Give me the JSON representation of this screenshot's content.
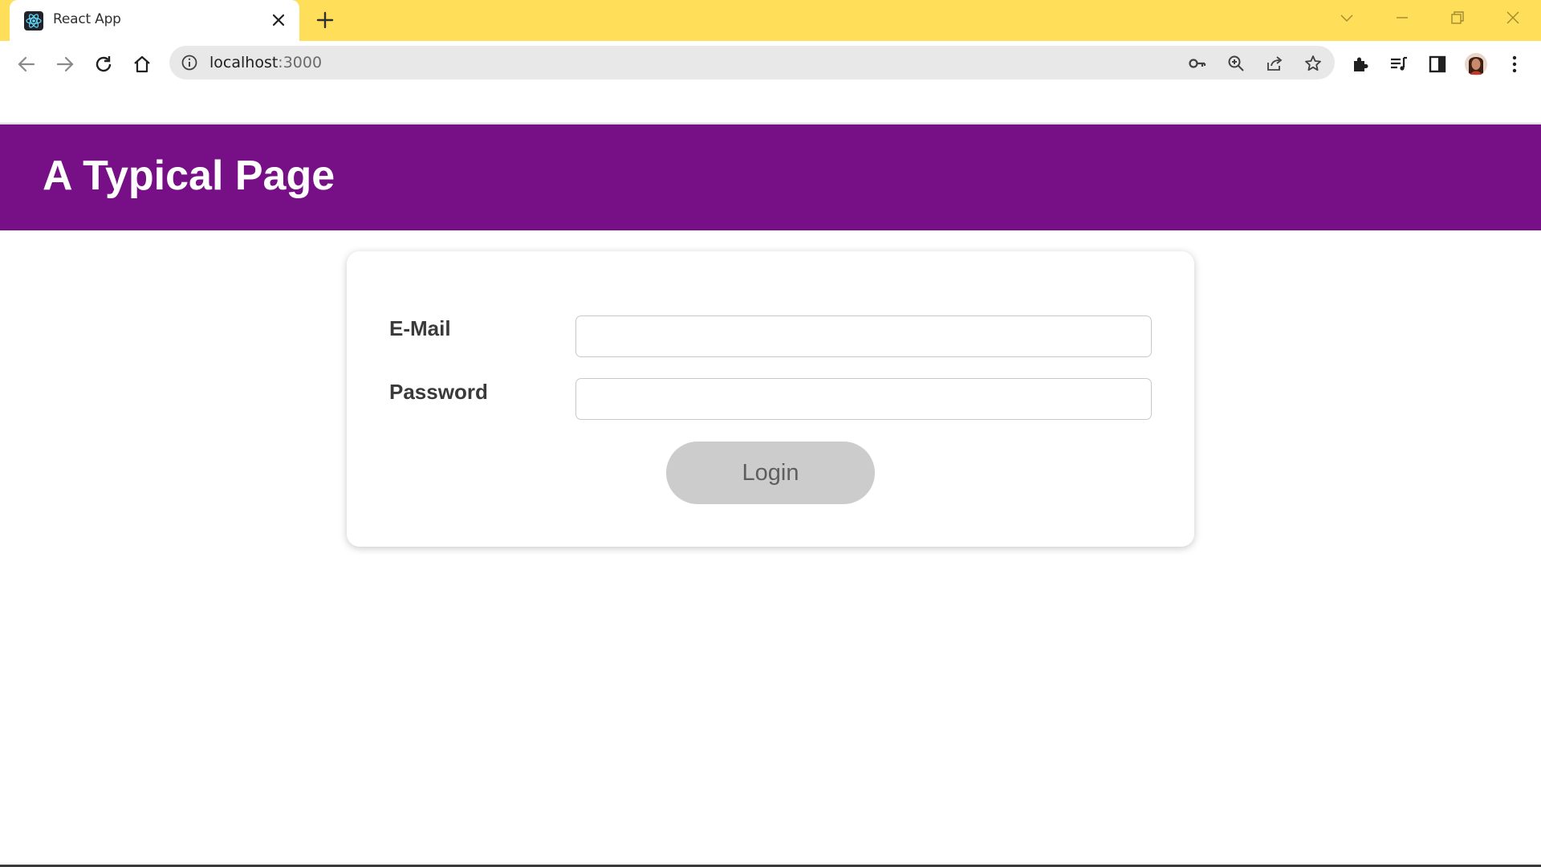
{
  "browser": {
    "tab_title": "React App",
    "url_host": "localhost",
    "url_port": ":3000",
    "icons": {
      "favicon": "react-logo-icon",
      "tab_close": "close-icon",
      "new_tab": "plus-icon",
      "tab_search": "chevron-down-icon",
      "minimize": "minimize-icon",
      "restore": "restore-icon",
      "close_window": "close-icon",
      "back": "arrow-left-icon",
      "forward": "arrow-right-icon",
      "reload": "reload-icon",
      "home": "home-icon",
      "site_info": "info-icon",
      "password": "key-icon",
      "zoom": "zoom-in-icon",
      "share": "share-icon",
      "bookmark": "star-icon",
      "extensions": "puzzle-icon",
      "media": "media-queue-icon",
      "side_panel": "side-panel-icon",
      "profile": "avatar",
      "menu": "kebab-menu-icon"
    },
    "colors": {
      "tabbar": "#ffde5a"
    }
  },
  "page": {
    "title": "A Typical Page",
    "header_color": "#771086"
  },
  "login_form": {
    "email_label": "E-Mail",
    "email_value": "",
    "password_label": "Password",
    "password_value": "",
    "submit_label": "Login",
    "submit_color": "#cccccc"
  }
}
